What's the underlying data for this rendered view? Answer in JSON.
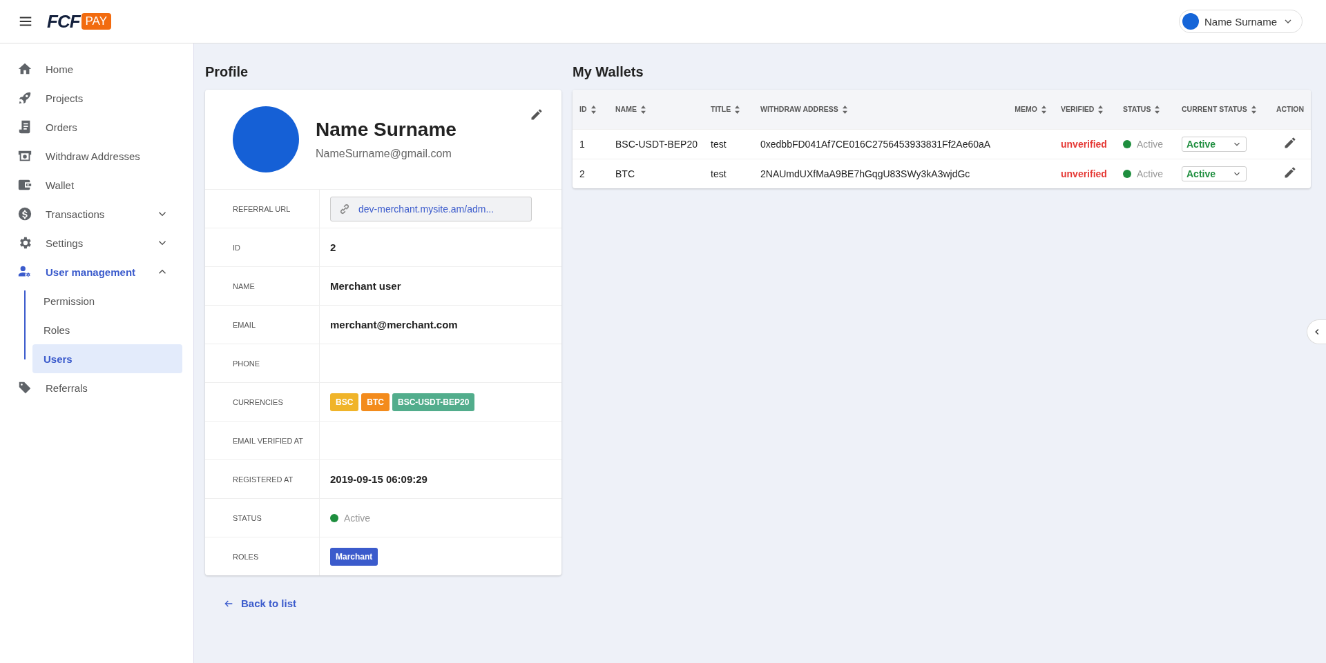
{
  "header": {
    "logo": {
      "brand": "FCF",
      "badge": "PAY"
    },
    "user_menu": {
      "name": "Name Surname"
    }
  },
  "sidebar": {
    "items": [
      {
        "label": "Home",
        "selected": false
      },
      {
        "label": "Projects",
        "selected": false
      },
      {
        "label": "Orders",
        "selected": false
      },
      {
        "label": "Withdraw Addresses",
        "selected": false
      },
      {
        "label": "Wallet",
        "selected": false
      },
      {
        "label": "Transactions",
        "selected": false,
        "expanded": false
      },
      {
        "label": "Settings",
        "selected": false,
        "expanded": false
      },
      {
        "label": "User management",
        "selected": true,
        "expanded": true,
        "children": [
          {
            "label": "Permission",
            "selected": false
          },
          {
            "label": "Roles",
            "selected": false
          },
          {
            "label": "Users",
            "selected": true
          }
        ]
      },
      {
        "label": "Referrals",
        "selected": false
      }
    ]
  },
  "profile": {
    "title": "Profile",
    "name": "Name Surname",
    "email": "NameSurname@gmail.com",
    "fields": [
      {
        "kind": "link",
        "label": "REFERRAL URL",
        "value": "dev-merchant.mysite.am/adm..."
      },
      {
        "kind": "text",
        "label": "ID",
        "value": "2"
      },
      {
        "kind": "text",
        "label": "NAME",
        "value": "Merchant user"
      },
      {
        "kind": "text",
        "label": "EMAIL",
        "value": "merchant@merchant.com"
      },
      {
        "kind": "text",
        "label": "PHONE"
      },
      {
        "kind": "tags",
        "label": "CURRENCIES",
        "tags": [
          {
            "text": "BSC",
            "color": "#f0b429"
          },
          {
            "text": "BTC",
            "color": "#f38b1c"
          },
          {
            "text": "BSC-USDT-BEP20",
            "color": "#52ad8c"
          }
        ]
      },
      {
        "kind": "text",
        "label": "EMAIL VERIFIED AT"
      },
      {
        "kind": "text",
        "label": "REGISTERED AT",
        "value": "2019-09-15 06:09:29"
      },
      {
        "kind": "status",
        "label": "STATUS",
        "value": "Active",
        "color": "#1e8e3e"
      },
      {
        "kind": "tags",
        "label": "ROLES",
        "tags": [
          {
            "text": "Marchant",
            "color": "#3b5bcc"
          }
        ]
      }
    ],
    "back_link": "Back to list"
  },
  "wallets": {
    "title": "My Wallets",
    "columns": [
      {
        "label": "ID",
        "sortable": true
      },
      {
        "label": "NAME",
        "sortable": true
      },
      {
        "label": "TITLE",
        "sortable": true
      },
      {
        "label": "WITHDRAW ADDRESS",
        "sortable": true
      },
      {
        "label": "MEMO",
        "sortable": true
      },
      {
        "label": "VERIFIED",
        "sortable": true
      },
      {
        "label": "STATUS",
        "sortable": true
      },
      {
        "label": "CURRENT STATUS",
        "sortable": true
      },
      {
        "label": "ACTION",
        "sortable": false
      }
    ],
    "rows": [
      {
        "id": "1",
        "name": "BSC-USDT-BEP20",
        "title": "test",
        "address": "0xedbbFD041Af7CE016C2756453933831Ff2Ae60aA",
        "verified": "unverified",
        "status": "Active",
        "color": "#1e8e3e",
        "current_status": "Active"
      },
      {
        "id": "2",
        "name": "BTC",
        "title": "test",
        "address": "2NAUmdUXfMaA9BE7hGqgU83SWy3kA3wjdGc",
        "verified": "unverified",
        "status": "Active",
        "color": "#1e8e3e",
        "current_status": "Active"
      }
    ]
  }
}
